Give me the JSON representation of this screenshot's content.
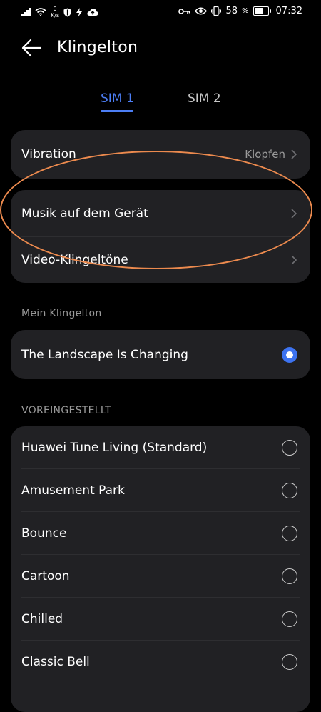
{
  "status_bar": {
    "net_speed_value": "0",
    "net_speed_unit": "K/s",
    "battery_percent": "58",
    "battery_percent_sign": "%",
    "time": "07:32"
  },
  "header": {
    "title": "Klingelton"
  },
  "tabs": [
    {
      "label": "SIM 1",
      "active": true
    },
    {
      "label": "SIM 2",
      "active": false
    }
  ],
  "settings": {
    "vibration": {
      "label": "Vibration",
      "value": "Klopfen"
    },
    "music_on_device": {
      "label": "Musik auf dem Gerät"
    },
    "video_ringtones": {
      "label": "Video-Klingeltöne"
    }
  },
  "my_ringtone": {
    "section_label": "Mein Klingelton",
    "item": {
      "label": "The Landscape Is Changing",
      "selected": true
    }
  },
  "preset": {
    "section_label": "VOREINGESTELLT",
    "items": [
      {
        "label": "Huawei Tune Living (Standard)",
        "selected": false
      },
      {
        "label": "Amusement Park",
        "selected": false
      },
      {
        "label": "Bounce",
        "selected": false
      },
      {
        "label": "Cartoon",
        "selected": false
      },
      {
        "label": "Chilled",
        "selected": false
      },
      {
        "label": "Classic Bell",
        "selected": false
      }
    ]
  },
  "colors": {
    "accent": "#4c7ef5",
    "card_background": "#212124",
    "highlight": "#ec8a4e"
  }
}
